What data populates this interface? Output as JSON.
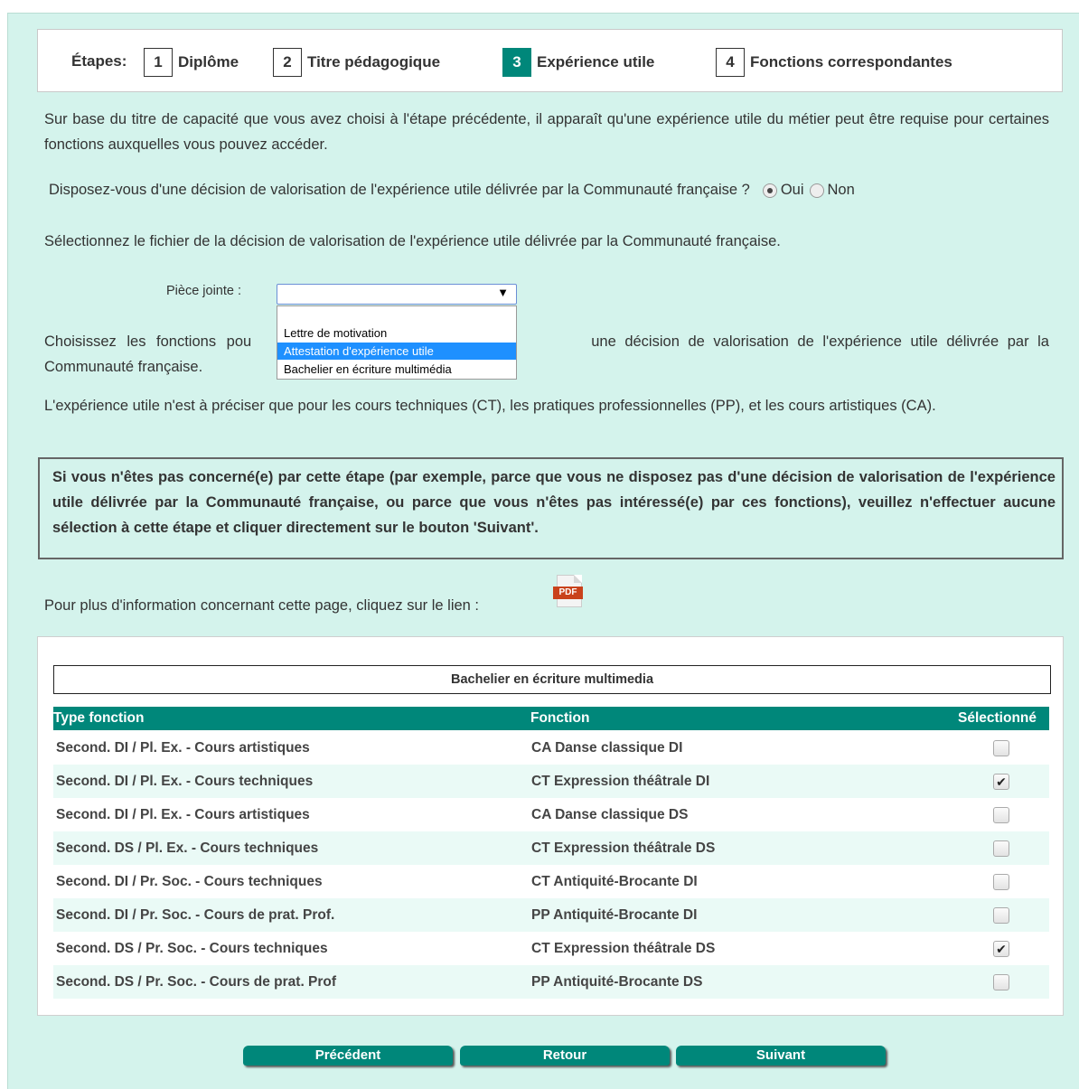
{
  "steps": {
    "label": "Étapes:",
    "items": [
      {
        "num": "1",
        "label": "Diplôme"
      },
      {
        "num": "2",
        "label": "Titre pédagogique"
      },
      {
        "num": "3",
        "label": "Expérience utile",
        "active": true
      },
      {
        "num": "4",
        "label": "Fonctions correspondantes"
      }
    ]
  },
  "intro": "Sur base du titre de capacité que vous avez choisi à l'étape précédente, il apparaît qu'une expérience utile du métier peut être requise pour certaines fonctions auxquelles vous pouvez accéder.",
  "question": {
    "text": "Disposez-vous d'une décision de valorisation de l'expérience utile délivrée par la Communauté française ?",
    "option_yes": "Oui",
    "option_no": "Non",
    "selected": "Oui"
  },
  "select_file_text": "Sélectionnez le fichier de la décision de valorisation de l'expérience utile délivrée par la Communauté française.",
  "attachment": {
    "label": "Pièce jointe :",
    "value": "",
    "options": [
      "",
      "Lettre de motivation",
      "Attestation d'expérience utile",
      "Bachelier en écriture multimédia"
    ],
    "highlighted": "Attestation d'expérience utile"
  },
  "choose_functions_text_a": "Choisissez les fonctions pou",
  "choose_functions_text_b": "une décision de valorisation de l'expérience utile délivrée par la",
  "choose_functions_text_c": "Communauté française.",
  "ct_pp_text": "L'expérience utile n'est à préciser que pour les cours techniques (CT), les pratiques professionnelles (PP), et les cours artistiques (CA).",
  "notice": "Si vous n'êtes pas concerné(e) par cette étape (par exemple, parce que vous ne disposez pas d'une décision de valorisation de l'expérience utile délivrée par la Communauté française, ou parce que vous n'êtes pas intéressé(e) par ces fonctions), veuillez n'effectuer aucune sélection à cette étape et cliquer directement sur le bouton 'Suivant'.",
  "info": {
    "text": "Pour plus d'information concernant cette page, cliquez sur le lien :",
    "pdf_label": "PDF"
  },
  "table": {
    "title": "Bachelier en écriture multimedia",
    "headers": [
      "Type fonction",
      "Fonction",
      "Sélectionné"
    ],
    "rows": [
      {
        "type": "Second. DI / Pl. Ex. - Cours artistiques",
        "fonction": "CA Danse classique DI",
        "selected": false
      },
      {
        "type": "Second. DI / Pl. Ex. - Cours techniques",
        "fonction": "CT Expression théâtrale DI",
        "selected": true
      },
      {
        "type": "Second. DI / Pl. Ex. - Cours artistiques",
        "fonction": "CA Danse classique DS",
        "selected": false
      },
      {
        "type": "Second. DS / Pl. Ex. - Cours techniques",
        "fonction": "CT Expression théâtrale DS",
        "selected": false
      },
      {
        "type": "Second. DI / Pr. Soc. - Cours techniques",
        "fonction": "CT Antiquité-Brocante DI",
        "selected": false
      },
      {
        "type": "Second. DI / Pr. Soc. - Cours de prat. Prof.",
        "fonction": "PP Antiquité-Brocante DI",
        "selected": false
      },
      {
        "type": "Second. DS / Pr. Soc. - Cours techniques",
        "fonction": "CT Expression théâtrale DS",
        "selected": true
      },
      {
        "type": "Second. DS / Pr. Soc. - Cours de prat. Prof",
        "fonction": "PP Antiquité-Brocante DS",
        "selected": false
      }
    ]
  },
  "buttons": {
    "previous": "Précédent",
    "back": "Retour",
    "next": "Suivant"
  },
  "colors": {
    "accent": "#00877a",
    "background": "#d4f3ec",
    "highlight": "#1e90ff"
  }
}
